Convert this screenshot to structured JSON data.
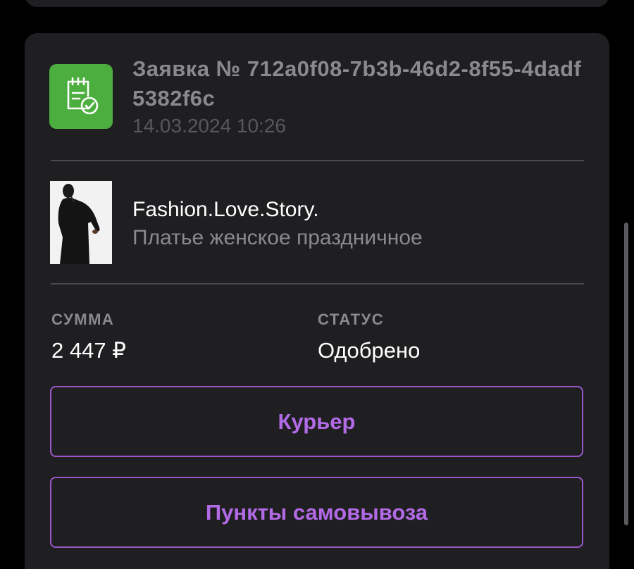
{
  "order": {
    "title": "Заявка № 712a0f08-7b3b-46d2-8f55-4dadf5382f6c",
    "date": "14.03.2024 10:26",
    "icon": "order-approved-icon",
    "icon_color": "#4cae3f"
  },
  "product": {
    "brand": "Fashion.Love.Story.",
    "description": "Платье женское праздничное",
    "image": "product-photo-dress"
  },
  "summary": {
    "amount_label": "СУММА",
    "amount_value": "2 447 ₽",
    "status_label": "СТАТУС",
    "status_value": "Одобрено"
  },
  "actions": {
    "courier_label": "Курьер",
    "pickup_label": "Пункты самовывоза",
    "accent_color": "#b36ae6"
  }
}
